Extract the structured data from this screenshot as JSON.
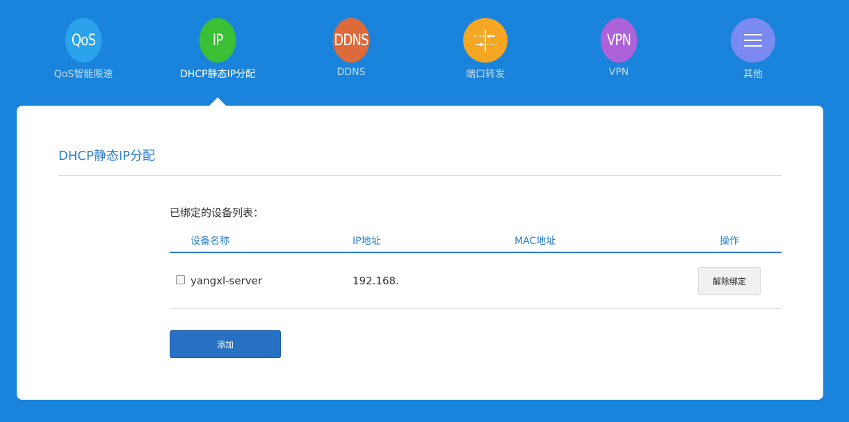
{
  "nav": {
    "items": [
      {
        "circle_text": "QoS",
        "label": "QoS智能限速",
        "color": "#2aa3ea",
        "icon": "qos-text"
      },
      {
        "circle_text": "IP",
        "label": "DHCP静态IP分配",
        "color": "#3bbf34",
        "icon": "ip-text",
        "active": true
      },
      {
        "circle_text": "DDNS",
        "label": "DDNS",
        "color": "#dd6a3a",
        "icon": "ddns-text"
      },
      {
        "circle_text": "",
        "label": "端口转发",
        "color": "#f5a623",
        "icon": "port-forward-icon"
      },
      {
        "circle_text": "VPN",
        "label": "VPN",
        "color": "#ad62da",
        "icon": "vpn-text"
      },
      {
        "circle_text": "",
        "label": "其他",
        "color": "#7b8af0",
        "icon": "menu-icon"
      }
    ]
  },
  "panel": {
    "title": "DHCP静态IP分配",
    "list_caption": "已绑定的设备列表：",
    "columns": [
      "设备名称",
      "IP地址",
      "MAC地址",
      "操作"
    ],
    "rows": [
      {
        "device_name": "yangxl-server",
        "ip": "192.168.",
        "mac": "",
        "action_label": "解除绑定",
        "checked": false
      }
    ],
    "add_label": "添加"
  },
  "colors": {
    "background": "#1a83dc",
    "accent": "#2a7fd0",
    "primary_button": "#2871c2"
  }
}
